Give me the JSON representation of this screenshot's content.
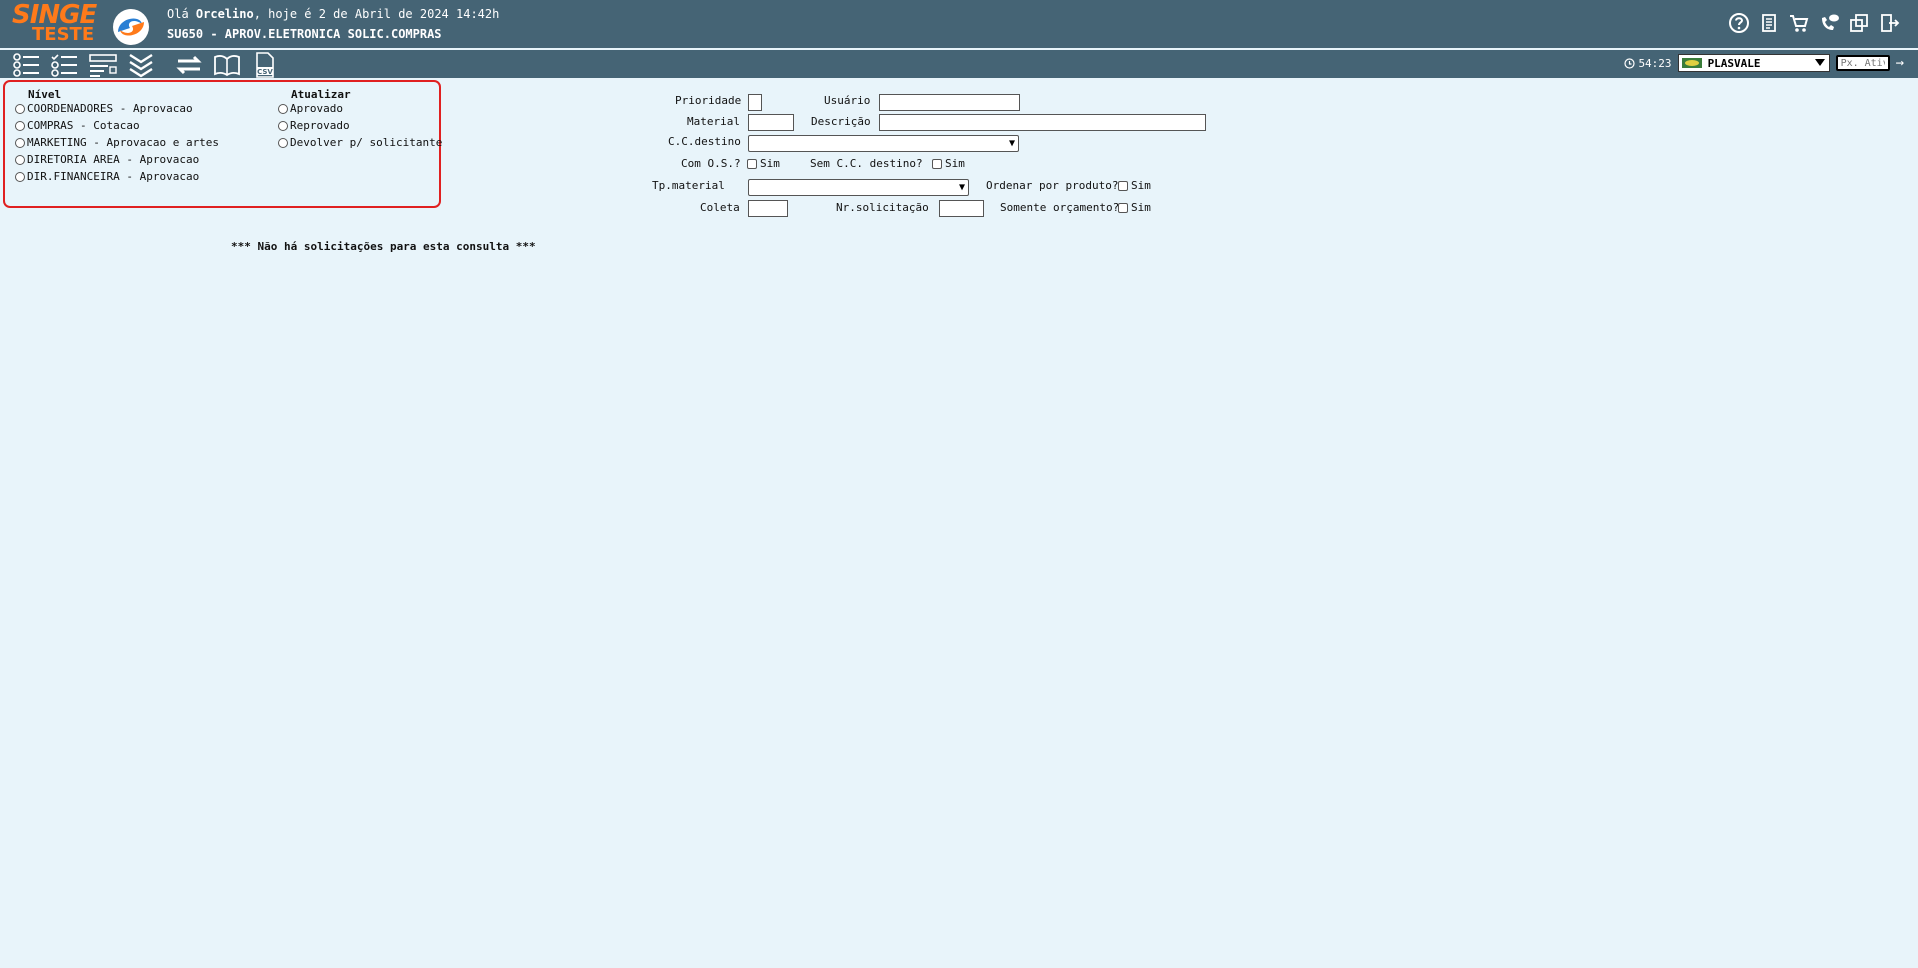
{
  "header": {
    "logo_top": "SINGE",
    "logo_bottom": "TESTE",
    "greeting_prefix": "Olá ",
    "user": "Orcelino",
    "greeting_suffix": ", hoje é 2 de Abril de 2024 14:42h",
    "program": "SU650 - APROV.ELETRONICA SOLIC.COMPRAS"
  },
  "toolbar": {
    "timer": "54:23",
    "company": "PLASVALE",
    "px_placeholder": "Px. Ativ",
    "csv_label": "CSV"
  },
  "nivel": {
    "title": "Nível",
    "options": [
      "COORDENADORES - Aprovacao",
      "COMPRAS - Cotacao",
      "MARKETING - Aprovacao e artes",
      "DIRETORIA AREA - Aprovacao",
      "DIR.FINANCEIRA - Aprovacao"
    ]
  },
  "atualizar": {
    "title": "Atualizar",
    "options": [
      "Aprovado",
      "Reprovado",
      "Devolver p/ solicitante"
    ]
  },
  "filters": {
    "prioridade": "Prioridade",
    "usuario": "Usuário",
    "material": "Material",
    "descricao": "Descrição",
    "cc_destino": "C.C.destino",
    "com_os": "Com O.S.?",
    "sem_cc": "Sem C.C. destino?",
    "tp_material": "Tp.material",
    "ordenar": "Ordenar por produto?",
    "coleta": "Coleta",
    "nr_solicitacao": "Nr.solicitação",
    "somente_orcamento": "Somente orçamento?",
    "sim": "Sim"
  },
  "message": "*** Não há solicitações para esta consulta ***",
  "colors": {
    "header_bg": "#456475",
    "page_bg": "#e8f4fa",
    "logo_orange": "#ff7a1a",
    "highlight_red": "#e02020"
  }
}
